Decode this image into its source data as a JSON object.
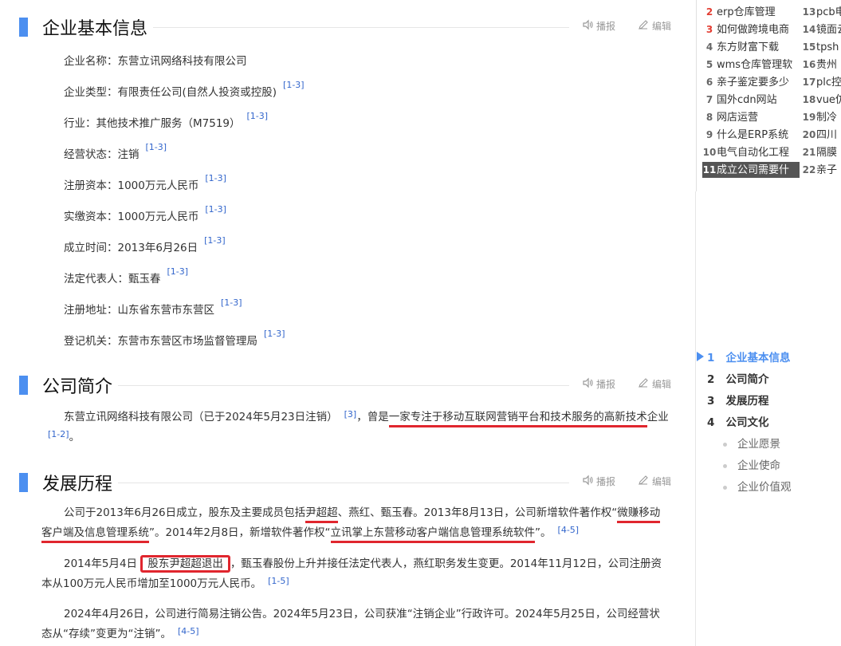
{
  "sections": {
    "basic": {
      "title": "企业基本信息",
      "play": "播报",
      "edit": "编辑"
    },
    "intro": {
      "title": "公司简介",
      "play": "播报",
      "edit": "编辑"
    },
    "history": {
      "title": "发展历程",
      "play": "播报",
      "edit": "编辑"
    }
  },
  "basic_info": [
    {
      "text": "企业名称：东营立讯网络科技有限公司",
      "ref": ""
    },
    {
      "text": "企业类型：有限责任公司(自然人投资或控股)",
      "ref": "[1-3]"
    },
    {
      "text": "行业：其他技术推广服务（M7519）",
      "ref": "[1-3]"
    },
    {
      "text": "经营状态：注销",
      "ref": "[1-3]"
    },
    {
      "text": "注册资本：1000万元人民币",
      "ref": "[1-3]"
    },
    {
      "text": "实缴资本：1000万元人民币",
      "ref": "[1-3]"
    },
    {
      "text": "成立时间：2013年6月26日",
      "ref": "[1-3]"
    },
    {
      "text": "法定代表人：甄玉春",
      "ref": "[1-3]"
    },
    {
      "text": "注册地址：山东省东营市东营区",
      "ref": "[1-3]"
    },
    {
      "text": "登记机关：东营市东营区市场监督管理局",
      "ref": "[1-3]"
    }
  ],
  "intro": {
    "p1a": "东营立讯网络科技有限公司（已于2024年5月23日注销）",
    "ref1": "[3]",
    "p1b": "，曾是",
    "p1hl": "一家专注于移动互联网营销平台和技术服务的高新技术",
    "p1c": "企业",
    "ref2": "[1-2]",
    "p1d": "。"
  },
  "history": {
    "p1a": "公司于2013年6月26日成立，股东及主要成员包括",
    "p1hl1": "尹超超",
    "p1b": "、燕红、甄玉春。2013年8月13日，公司新增软件著作权“",
    "p1hl2": "微赚移动客户端及信息管理系统",
    "p1c": "”。2014年2月8日，新增软件著作权“",
    "p1hl3": "立讯掌上东营移动客户端信息管理系统软件",
    "p1d": "”。",
    "ref1": "[4-5]",
    "p2a": "2014年5月4日",
    "p2box": "股东尹超超退出",
    "p2b": "，甄玉春股份上升并接任法定代表人，燕红职务发生变更。2014年11月12日，公司注册资本从100万元人民币增加至1000万元人民币。",
    "ref2": "[1-5]",
    "p3": "2024年4月26日，公司进行简易注销公告。2024年5月23日，公司获准“注销企业”行政许可。2024年5月25日，公司经营状态从“存续”变更为“注销”。",
    "ref3": "[4-5]"
  },
  "rank_left": [
    {
      "num": "2",
      "label": "erp仓库管理"
    },
    {
      "num": "3",
      "label": "如何做跨境电商"
    },
    {
      "num": "4",
      "label": "东方财富下载"
    },
    {
      "num": "5",
      "label": "wms仓库管理软"
    },
    {
      "num": "6",
      "label": "亲子鉴定要多少"
    },
    {
      "num": "7",
      "label": "国外cdn网站"
    },
    {
      "num": "8",
      "label": "网店运营"
    },
    {
      "num": "9",
      "label": "什么是ERP系统"
    },
    {
      "num": "10",
      "label": "电气自动化工程"
    },
    {
      "num": "11",
      "label": "成立公司需要什"
    }
  ],
  "rank_right": [
    {
      "num": "13",
      "label": "pcb电"
    },
    {
      "num": "14",
      "label": "镜面云"
    },
    {
      "num": "15",
      "label": "tpsh"
    },
    {
      "num": "16",
      "label": "贵州"
    },
    {
      "num": "17",
      "label": "plc控"
    },
    {
      "num": "18",
      "label": "vue仿"
    },
    {
      "num": "19",
      "label": "制冷"
    },
    {
      "num": "20",
      "label": "四川"
    },
    {
      "num": "21",
      "label": "隔膜"
    },
    {
      "num": "22",
      "label": "亲子"
    }
  ],
  "toc": [
    {
      "num": "1",
      "label": "企业基本信息"
    },
    {
      "num": "2",
      "label": "公司简介"
    },
    {
      "num": "3",
      "label": "发展历程"
    },
    {
      "num": "4",
      "label": "公司文化"
    }
  ],
  "toc_sub": [
    "企业愿景",
    "企业使命",
    "企业价值观"
  ],
  "colors": {
    "accent": "#4c8ff0",
    "highlight": "#e0262e",
    "rank_top": "#e33e33"
  }
}
